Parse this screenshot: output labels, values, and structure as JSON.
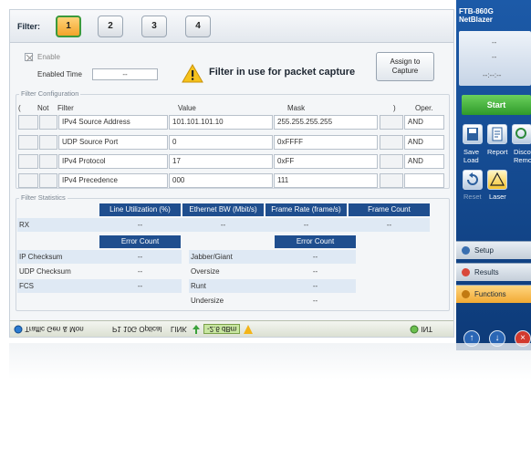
{
  "filter_bar": {
    "label": "Filter:",
    "buttons": [
      "1",
      "2",
      "3",
      "4"
    ],
    "active": "1"
  },
  "enable": {
    "label": "Enable",
    "enabled_time_label": "Enabled Time",
    "enabled_time_value": "--"
  },
  "warning": {
    "text": "Filter in use for packet capture"
  },
  "assign_button": {
    "line1": "Assign to",
    "line2": "Capture"
  },
  "filter_config": {
    "title": "Filter Configuration",
    "headers": {
      "open_paren": "(",
      "not": "Not",
      "filter": "Filter",
      "value": "Value",
      "mask": "Mask",
      "close_paren": ")",
      "oper": "Oper."
    },
    "rows": [
      {
        "filter": "IPv4 Source Address",
        "value": "101.101.101.10",
        "mask": "255.255.255.255",
        "oper": "AND"
      },
      {
        "filter": "UDP Source Port",
        "value": "0",
        "mask": "0xFFFF",
        "oper": "AND"
      },
      {
        "filter": "IPv4 Protocol",
        "value": "17",
        "mask": "0xFF",
        "oper": "AND"
      },
      {
        "filter": "IPv4 Precedence",
        "value": "000",
        "mask": "111",
        "oper": ""
      }
    ]
  },
  "filter_stats": {
    "title": "Filter Statistics",
    "headers": [
      "Line Utilization (%)",
      "Ethernet BW (Mbit/s)",
      "Frame Rate (frame/s)",
      "Frame Count"
    ],
    "rx": {
      "label": "RX",
      "values": [
        "--",
        "--",
        "--",
        "--"
      ]
    },
    "error_count_label": "Error Count",
    "left_errors": [
      {
        "label": "IP Checksum",
        "value": "--"
      },
      {
        "label": "UDP Checksum",
        "value": "--"
      },
      {
        "label": "FCS",
        "value": "--"
      }
    ],
    "right_errors": [
      {
        "label": "Jabber/Giant",
        "value": "--"
      },
      {
        "label": "Oversize",
        "value": "--"
      },
      {
        "label": "Runt",
        "value": "--"
      },
      {
        "label": "Undersize",
        "value": "--"
      }
    ]
  },
  "status_bar": {
    "app": "Traffic Gen & Mon",
    "port": "P1 10G Optical",
    "link": "LINK",
    "power": "-2.6 dBm",
    "int": "INT"
  },
  "sidebar": {
    "model": "FTB-860G",
    "product": "NetBlazer",
    "panel_dashes": [
      "--",
      "--",
      "--:--:--"
    ],
    "start_label": "Start",
    "tools": [
      {
        "label1": "Save",
        "label2": "Load"
      },
      {
        "label1": "Report",
        "label2": ""
      },
      {
        "label1": "Discov",
        "label2": "Remo"
      }
    ],
    "tools2": [
      {
        "label": "Reset"
      },
      {
        "label": "Laser"
      }
    ],
    "nav": [
      "Setup",
      "Results",
      "Functions"
    ],
    "colors": {
      "start": "#3cae34",
      "active_nav": "#f1a934",
      "header_blue": "#1f4e8e"
    }
  }
}
